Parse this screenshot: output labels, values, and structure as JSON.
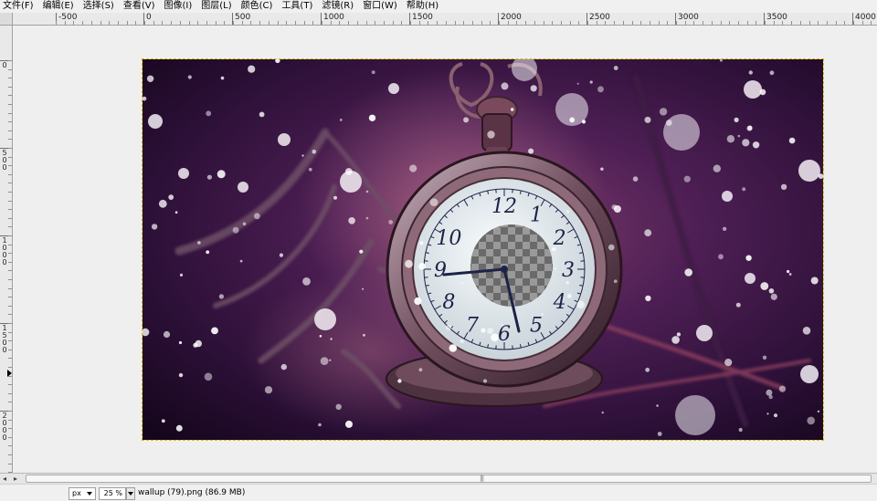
{
  "menu": {
    "items": [
      "文件(F)",
      "编辑(E)",
      "选择(S)",
      "查看(V)",
      "图像(I)",
      "图层(L)",
      "颜色(C)",
      "工具(T)",
      "滤镜(R)",
      "窗口(W)",
      "帮助(H)"
    ]
  },
  "rulers": {
    "horizontal_labels": [
      "-500",
      "0",
      "500",
      "1000",
      "1500",
      "2000",
      "2500",
      "3000",
      "3500",
      "4000"
    ],
    "vertical_labels": [
      "0",
      "500",
      "1000",
      "1500",
      "2000"
    ]
  },
  "image": {
    "subject": "pocket watch with snowflakes on purple background",
    "clock_numerals": [
      "12",
      "1",
      "2",
      "3",
      "4",
      "5",
      "6",
      "7",
      "8",
      "9",
      "10"
    ],
    "colors": {
      "background_dark": "#1e0a28",
      "background_purple": "#5b2660",
      "highlight_pink": "#8a4a6e",
      "watch_metal": "#6b4a58",
      "dial": "#e8eef2",
      "numerals": "#1c2346",
      "selection_outline": "#d8c000"
    }
  },
  "status": {
    "unit": "px",
    "zoom": "25 %",
    "file_info": "wallup (79).png (86.9 MB)"
  },
  "icons": {
    "scroll_left": "left-arrow-icon",
    "nav": "navigate-icon",
    "grip": "grip-icon",
    "vertical_marker": "pointer-marker-icon"
  }
}
